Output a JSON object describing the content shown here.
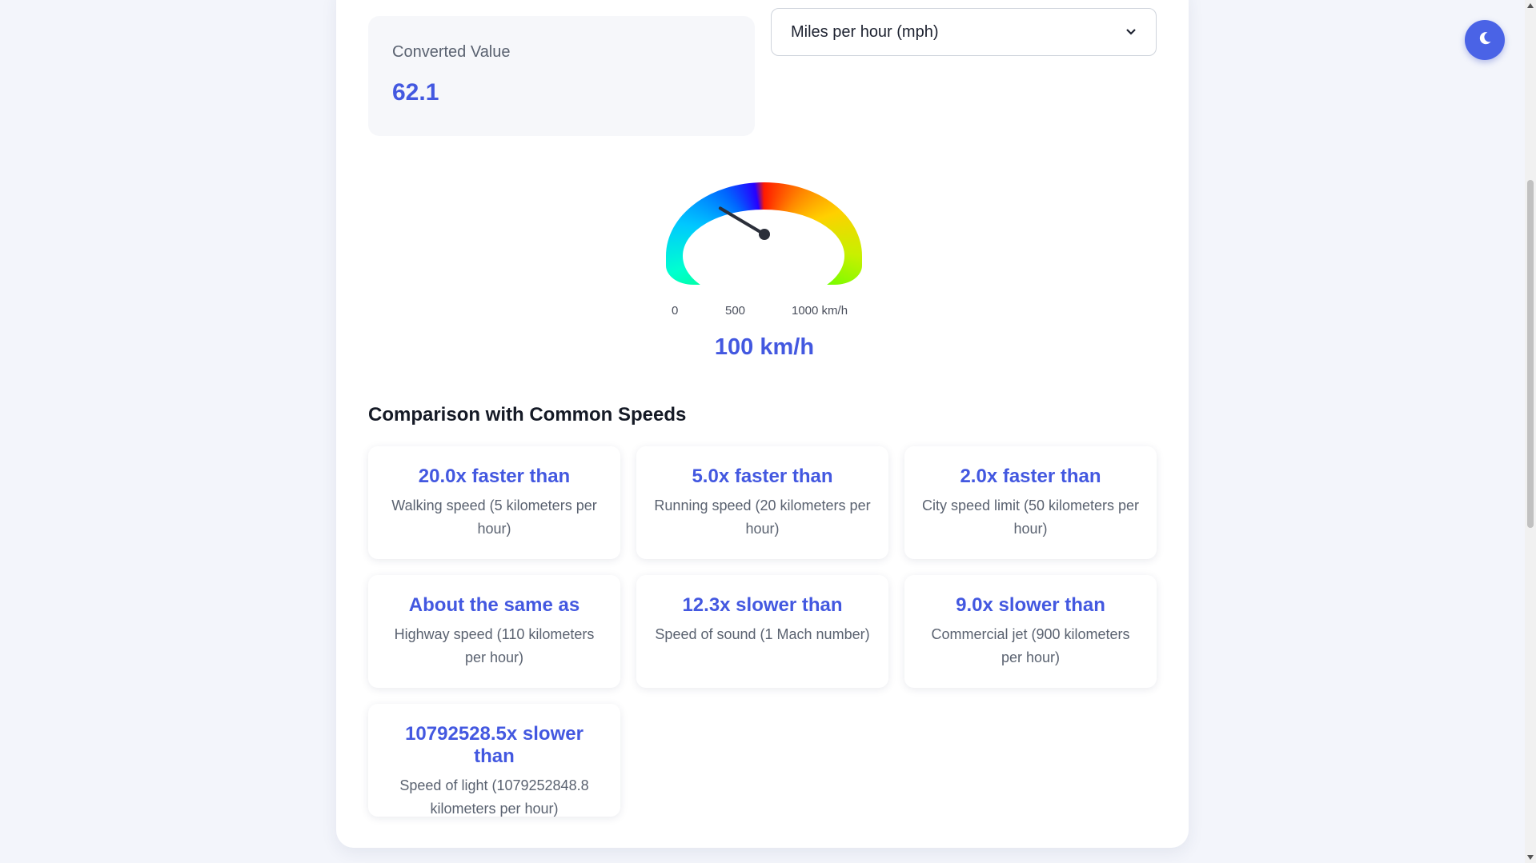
{
  "converted": {
    "label": "Converted Value",
    "value": "62.1"
  },
  "unit_select": {
    "selected": "Miles per hour (mph)"
  },
  "gauge": {
    "ticks": [
      "0",
      "500",
      "1000 km/h"
    ],
    "readout": "100 km/h",
    "speed_kmh": 100,
    "max_kmh": 1000
  },
  "comparison": {
    "title": "Comparison with Common Speeds",
    "items": [
      {
        "headline": "20.0x faster than",
        "desc": "Walking speed (5 kilometers per hour)"
      },
      {
        "headline": "5.0x faster than",
        "desc": "Running speed (20 kilometers per hour)"
      },
      {
        "headline": "2.0x faster than",
        "desc": "City speed limit (50 kilometers per hour)"
      },
      {
        "headline": "About the same as",
        "desc": "Highway speed (110 kilometers per hour)"
      },
      {
        "headline": "12.3x slower than",
        "desc": "Speed of sound (1 Mach number)"
      },
      {
        "headline": "9.0x slower than",
        "desc": "Commercial jet (900 kilometers per hour)"
      },
      {
        "headline": "10792528.5x slower than",
        "desc": "Speed of light (1079252848.8 kilometers per hour)"
      }
    ]
  },
  "colors": {
    "accent": "#4358e0",
    "theme_button": "#4a63e6"
  },
  "icons": {
    "theme_toggle": "moon-icon",
    "select_caret": "chevron-down-icon"
  }
}
